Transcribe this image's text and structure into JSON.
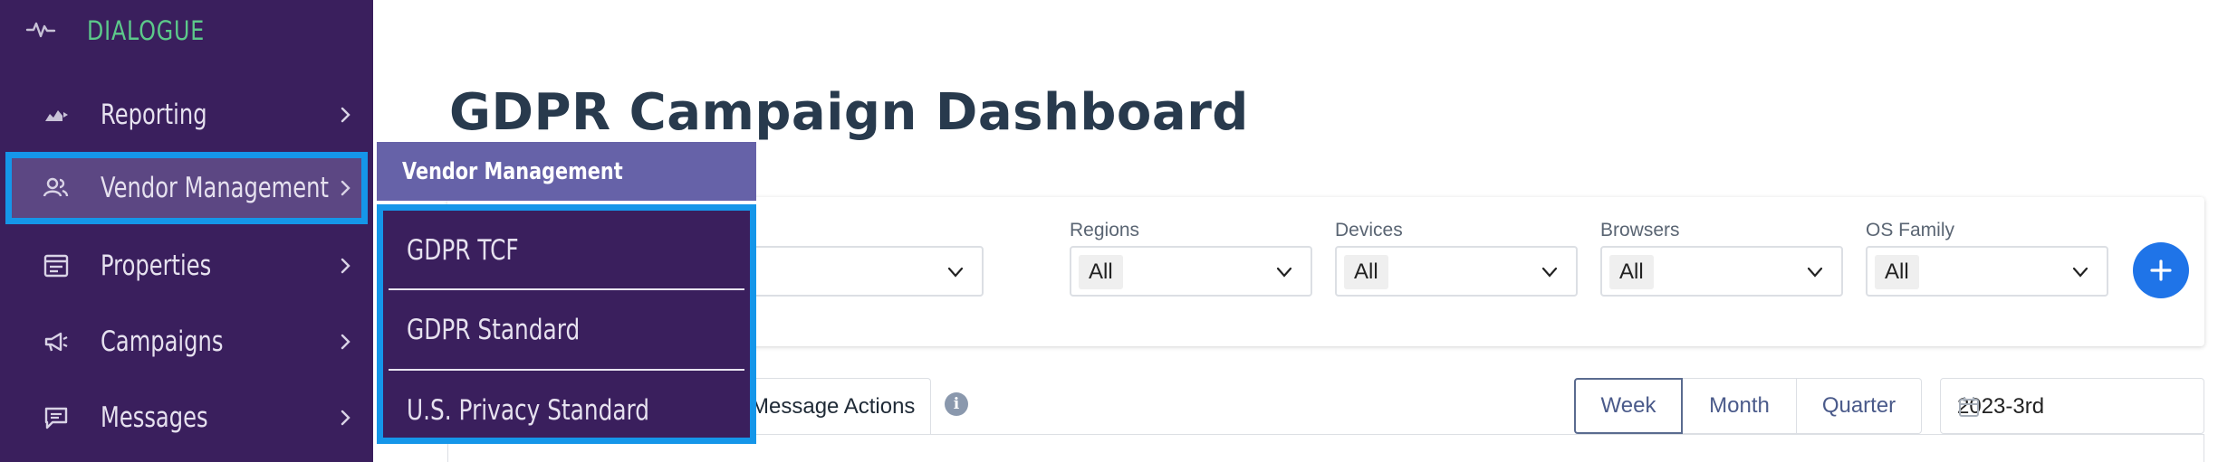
{
  "app": {
    "brand": "DIALOGUE"
  },
  "sidebar": {
    "items": [
      {
        "label": "Reporting",
        "icon": "chart-icon"
      },
      {
        "label": "Vendor Management",
        "icon": "users-icon",
        "active": true
      },
      {
        "label": "Properties",
        "icon": "properties-icon"
      },
      {
        "label": "Campaigns",
        "icon": "megaphone-icon"
      },
      {
        "label": "Messages",
        "icon": "message-icon"
      }
    ]
  },
  "flyout": {
    "title": "Vendor Management",
    "items": [
      {
        "label": "GDPR TCF"
      },
      {
        "label": "GDPR Standard"
      },
      {
        "label": "U.S. Privacy Standard"
      }
    ]
  },
  "main": {
    "title": "GDPR Campaign Dashboard",
    "filters": [
      {
        "label": "Regions",
        "value": "All"
      },
      {
        "label": "Devices",
        "value": "All"
      },
      {
        "label": "Browsers",
        "value": "All"
      },
      {
        "label": "OS Family",
        "value": "All"
      }
    ],
    "tabs": {
      "message_actions": "Message Actions",
      "info_icon": "i"
    },
    "period": {
      "week": "Week",
      "month": "Month",
      "quarter": "Quarter",
      "selected": "Week"
    },
    "date_value": "2023-3rd"
  },
  "colors": {
    "sidebar_bg": "#3a1f5d",
    "brand_green": "#5cc98a",
    "active_item_bg": "#5c4783",
    "highlight_blue": "#1596e9",
    "flyout_header_bg": "#6662a8",
    "primary_blue": "#1f74e8",
    "title_text": "#283a4d"
  }
}
